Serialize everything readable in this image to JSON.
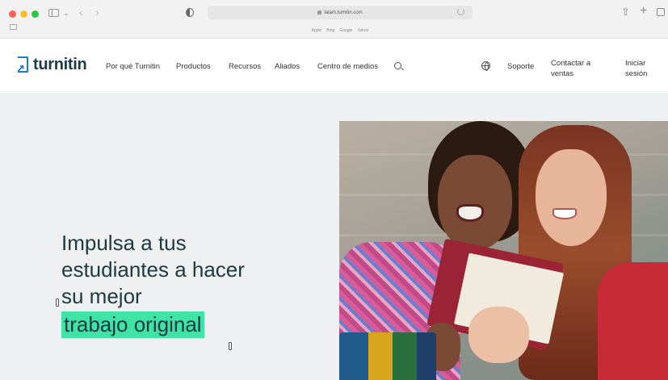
{
  "browser": {
    "url": "latam.turnitin.com",
    "favorites": [
      "Apple",
      "Bing",
      "Google",
      "Yahoo"
    ]
  },
  "site": {
    "logo_text": "turnitin",
    "brand_color": "#1b79d0",
    "nav": {
      "items": [
        "Por qué Turnitin",
        "Productos",
        "Recursos",
        "Aliados",
        "Centro de medios"
      ],
      "support": "Soporte",
      "contact": "Contactar a ventas",
      "login": "Iniciar sesión"
    }
  },
  "hero": {
    "line1": "Impulsa a tus",
    "line2": "estudiantes a hacer",
    "line3": "su mejor",
    "highlight": "trabajo original",
    "highlight_color": "#3ee3a5"
  },
  "icons": {
    "search": "search-icon",
    "globe": "globe-icon",
    "share": "share-icon",
    "new_tab": "plus-icon",
    "tabs": "tabs-overview-icon"
  }
}
